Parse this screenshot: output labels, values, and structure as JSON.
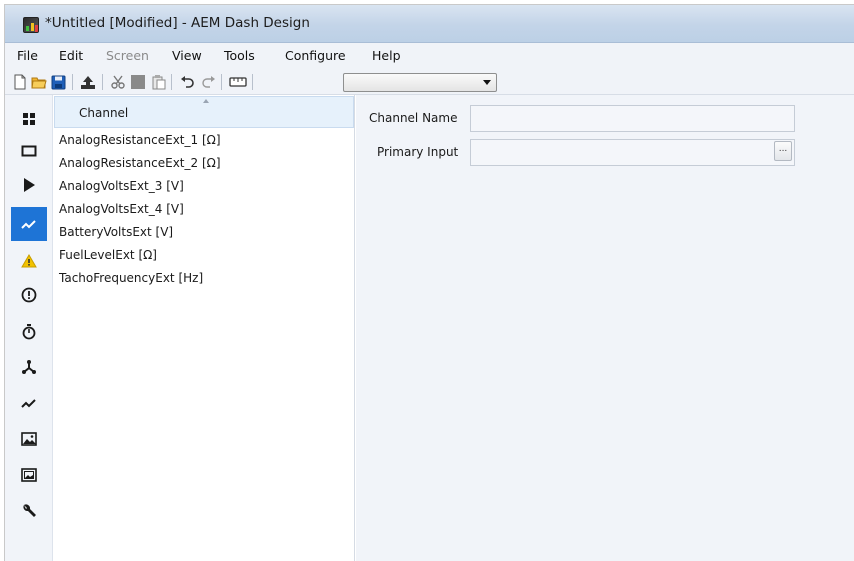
{
  "window": {
    "title": "*Untitled [Modified] - AEM Dash Design"
  },
  "menu": [
    {
      "label": "File",
      "disabled": false
    },
    {
      "label": "Edit",
      "disabled": false
    },
    {
      "label": "Screen",
      "disabled": true
    },
    {
      "label": "View",
      "disabled": false
    },
    {
      "label": "Tools",
      "disabled": false
    },
    {
      "label": "Configure",
      "disabled": false
    },
    {
      "label": "Help",
      "disabled": false
    }
  ],
  "toolbar": {
    "icons": [
      "new-file-icon",
      "open-folder-icon",
      "save-icon",
      "upload-icon",
      "cut-icon",
      "copy-icon",
      "paste-icon",
      "undo-icon",
      "redo-icon",
      "ruler-icon"
    ],
    "dropdown_value": ""
  },
  "sidebar": {
    "icons": [
      "grid-icon",
      "rectangle-icon",
      "play-icon",
      "chart-line-icon",
      "warning-icon",
      "alert-circle-icon",
      "stopwatch-icon",
      "network-icon",
      "trend-line-icon",
      "image-icon",
      "image-frame-icon",
      "wrench-icon"
    ],
    "active_index": 3
  },
  "channel_list": {
    "header": "Channel",
    "items": [
      "AnalogResistanceExt_1 [Ω]",
      "AnalogResistanceExt_2 [Ω]",
      "AnalogVoltsExt_3 [V]",
      "AnalogVoltsExt_4 [V]",
      "BatteryVoltsExt [V]",
      "FuelLevelExt [Ω]",
      "TachoFrequencyExt [Hz]"
    ]
  },
  "properties": {
    "channel_name_label": "Channel Name",
    "channel_name_value": "",
    "primary_input_label": "Primary Input",
    "primary_input_value": "",
    "browse_label": "..."
  },
  "colors": {
    "active_sidebar": "#1e74d6",
    "header_highlight": "#e6f1fb",
    "warning": "#f2c200"
  }
}
